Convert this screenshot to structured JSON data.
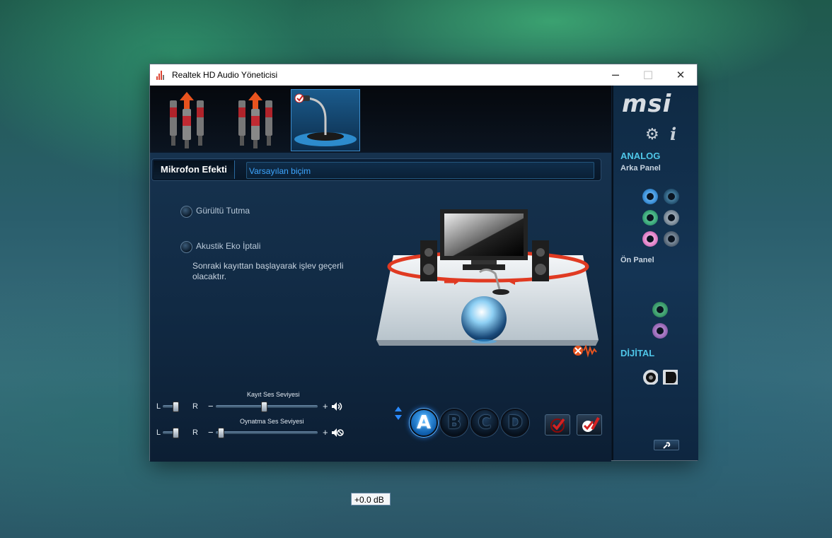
{
  "window": {
    "title": "Realtek HD Audio Yöneticisi",
    "minimize_glyph": "─",
    "maximize_glyph": "☐",
    "close_glyph": "✕"
  },
  "tabs": {
    "active_label": "Mikrofon Efekti",
    "sub_label": "Varsayılan biçim"
  },
  "options": {
    "noise": "Gürültü Tutma",
    "echo": "Akustik Eko İptali",
    "note": "Sonraki kayıttan başlayarak işlev geçerli olacaktır."
  },
  "volume": {
    "record_label": "Kayıt Ses Seviyesi",
    "playback_label": "Oynatma Ses Seviyesi",
    "left_label": "L",
    "right_label": "R",
    "minus": "−",
    "plus": "+",
    "db_value": "+0.0 dB",
    "record_level": 0.47,
    "playback_level": 0.02
  },
  "profiles": {
    "a": "A",
    "b": "B",
    "c": "C",
    "d": "D"
  },
  "sidebar": {
    "brand": "msi",
    "analog": "ANALOG",
    "rear_panel": "Arka Panel",
    "front_panel": "Ön Panel",
    "digital": "DİJİTAL"
  },
  "colors": {
    "accent_blue": "#3ea6ff",
    "analog_heading": "#4fc6e8",
    "jack_blue": "#3a8fd8",
    "jack_green": "#3aa87a",
    "jack_pink": "#e080c8",
    "jack_gray": "#7a8a98",
    "front_green": "#3a9a6a",
    "front_pink": "#9a6ab8"
  },
  "icons": {
    "gear": "⚙",
    "info": "i",
    "speaker": "🔊",
    "mute": "🔇",
    "wrench": "🔧"
  }
}
